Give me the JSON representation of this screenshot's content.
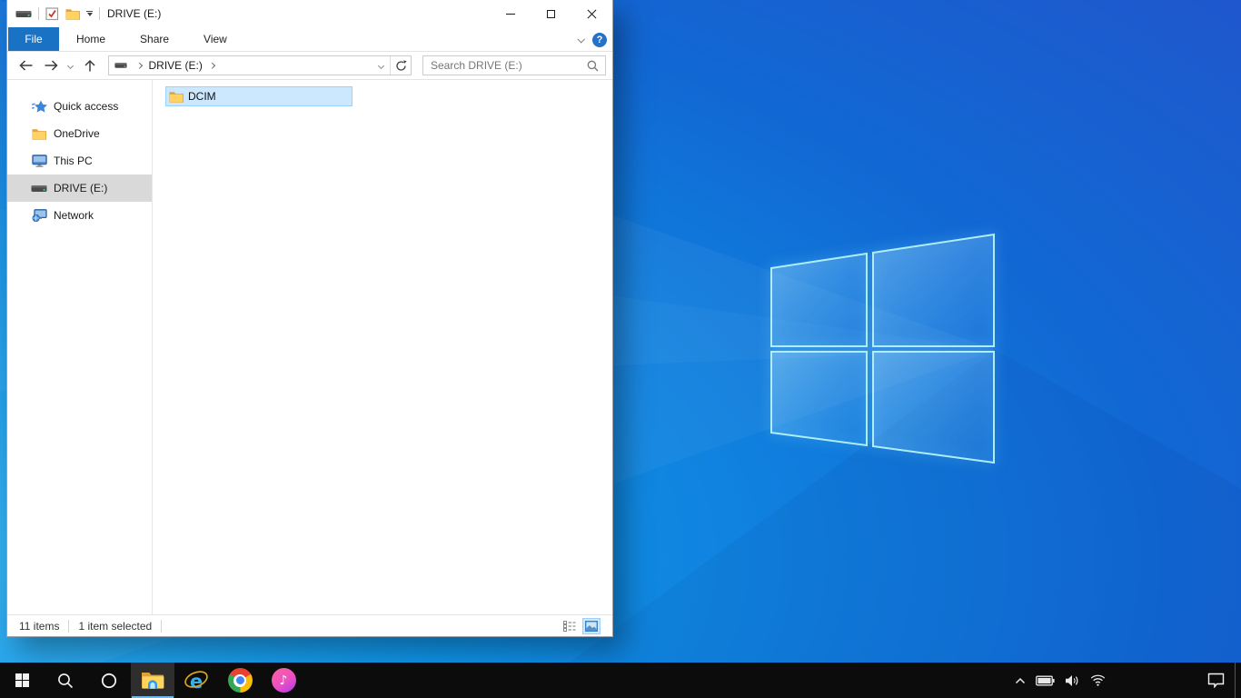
{
  "window": {
    "title": "DRIVE (E:)"
  },
  "ribbon": {
    "tabs": [
      {
        "label": "File",
        "active": true
      },
      {
        "label": "Home",
        "active": false
      },
      {
        "label": "Share",
        "active": false
      },
      {
        "label": "View",
        "active": false
      }
    ],
    "help_label": "?"
  },
  "address": {
    "breadcrumb_root": "DRIVE (E:)"
  },
  "search": {
    "placeholder": "Search DRIVE (E:)"
  },
  "sidebar": {
    "items": [
      {
        "label": "Quick access",
        "icon": "quick-access-star",
        "selected": false
      },
      {
        "label": "OneDrive",
        "icon": "folder",
        "selected": false
      },
      {
        "label": "This PC",
        "icon": "monitor",
        "selected": false
      },
      {
        "label": "DRIVE (E:)",
        "icon": "hard-drive",
        "selected": true
      },
      {
        "label": "Network",
        "icon": "network",
        "selected": false
      }
    ]
  },
  "files": [
    {
      "name": "DCIM",
      "icon": "folder",
      "selected": true
    }
  ],
  "statusbar": {
    "total": "11 items",
    "selected": "1 item selected"
  },
  "taskbar": {
    "buttons": [
      {
        "name": "start",
        "active": false
      },
      {
        "name": "search",
        "active": false
      },
      {
        "name": "cortana",
        "active": false
      },
      {
        "name": "file-explorer",
        "active": true
      },
      {
        "name": "internet-explorer",
        "active": false
      },
      {
        "name": "chrome",
        "active": false
      },
      {
        "name": "itunes",
        "active": false
      }
    ]
  },
  "tray": {
    "icons": [
      "chevron-up",
      "battery",
      "volume",
      "wifi"
    ],
    "action_center": "notifications"
  },
  "colors": {
    "file_tab_bg": "#1a72c4",
    "selection_bg": "#cce8ff",
    "selection_border": "#99d1ff",
    "sidebar_selected_bg": "#d9d9d9",
    "taskbar_bg": "#0c0c0c",
    "taskbar_active_underline": "#71b6e7",
    "wallpaper_bright": "#2fb1f2",
    "wallpaper_deep": "#2254cc"
  }
}
